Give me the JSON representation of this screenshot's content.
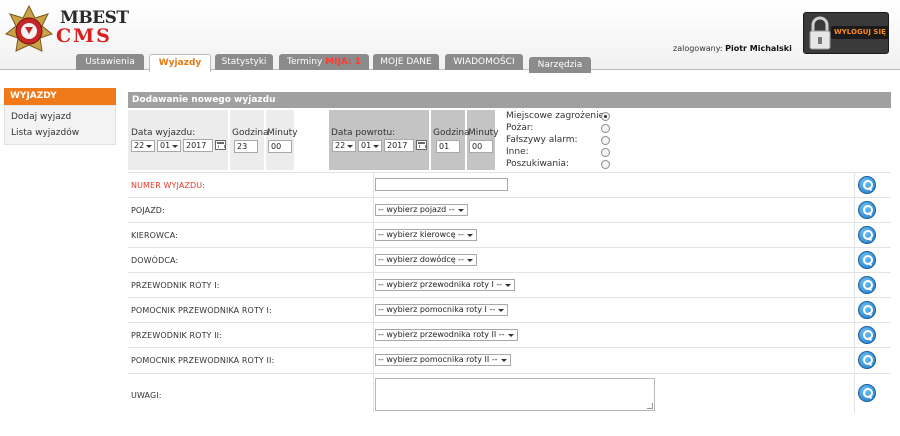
{
  "header": {
    "logo_top": "MBEST",
    "logo_bottom": "CMS",
    "user_label": "zalogowany:",
    "user_name": "Piotr Michalski",
    "logout_label": "WYLOGUJ SIĘ"
  },
  "tabs": [
    {
      "label": "Ustawienia",
      "active": false
    },
    {
      "label": "Wyjazdy",
      "active": true
    },
    {
      "label": "Statystyki",
      "active": false
    },
    {
      "label": "Terminy",
      "highlight": "MIJA: 1",
      "active": false
    },
    {
      "label": "MOJE DANE",
      "active": false
    },
    {
      "label": "WIADOMOŚCI",
      "active": false
    },
    {
      "label": "Narzędzia",
      "active": false
    }
  ],
  "sidebar": {
    "title": "WYJAZDY",
    "items": [
      {
        "label": "Dodaj wyjazd"
      },
      {
        "label": "Lista wyjazdów"
      }
    ]
  },
  "form": {
    "title": "Dodawanie nowego wyjazdu",
    "departure": {
      "date_label": "Data wyjazdu:",
      "day": "22",
      "month": "01",
      "year": "2017",
      "hour_label": "Godzina",
      "hour": "23",
      "minute_label": "Minuty",
      "minute": "00"
    },
    "return": {
      "date_label": "Data powrotu:",
      "day": "22",
      "month": "01",
      "year": "2017",
      "hour_label": "Godzina",
      "hour": "01",
      "minute_label": "Minuty",
      "minute": "00"
    },
    "types": [
      {
        "label": "Miejscowe zagrożenie:",
        "checked": true
      },
      {
        "label": "Pożar:",
        "checked": false
      },
      {
        "label": "Fałszywy alarm:",
        "checked": false
      },
      {
        "label": "Inne:",
        "checked": false
      },
      {
        "label": "Poszukiwania:",
        "checked": false
      }
    ],
    "fields": [
      {
        "label": "NUMER WYJAZDU:",
        "required": true,
        "type": "text",
        "value": ""
      },
      {
        "label": "POJAZD:",
        "type": "select",
        "value": "-- wybierz pojazd --"
      },
      {
        "label": "KIEROWCA:",
        "type": "select",
        "value": "-- wybierz kierowcę --"
      },
      {
        "label": "DOWÓDCA:",
        "type": "select",
        "value": "-- wybierz dowódcę --"
      },
      {
        "label": "PRZEWODNIK ROTY I:",
        "type": "select",
        "value": "-- wybierz przewodnika roty I --"
      },
      {
        "label": "POMOCNIK PRZEWODNIKA ROTY I:",
        "type": "select",
        "value": "-- wybierz pomocnika roty I --"
      },
      {
        "label": "PRZEWODNIK ROTY II:",
        "type": "select",
        "value": "-- wybierz przewodnika roty II --"
      },
      {
        "label": "POMOCNIK PRZEWODNIKA ROTY II:",
        "type": "select",
        "value": "-- wybierz pomocnika roty II --"
      },
      {
        "label": "UWAGI:",
        "type": "textarea",
        "value": ""
      }
    ]
  },
  "colors": {
    "accent_orange": "#f07a1a",
    "required_red": "#e53b2a",
    "tab_gray": "#8b8b8b",
    "help_blue": "#1e78c6"
  }
}
